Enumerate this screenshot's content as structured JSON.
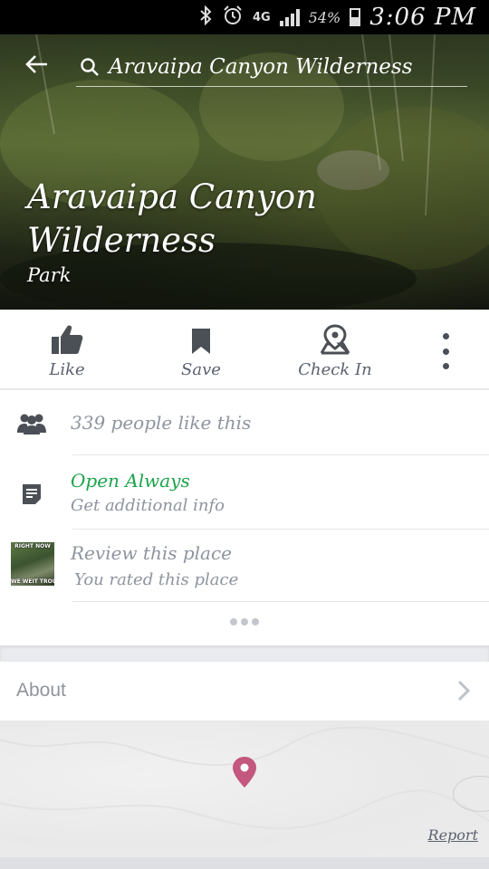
{
  "status_bar": {
    "icons": [
      "bluetooth-icon",
      "alarm-icon",
      "signal-icon",
      "battery-icon"
    ],
    "network": "4G",
    "battery": "54%",
    "time": "3:06 PM"
  },
  "header": {
    "search_query": "Aravaipa Canyon Wilderness",
    "title": "Aravaipa Canyon Wilderness",
    "category": "Park"
  },
  "actions": [
    {
      "label": "Like",
      "icon": "thumbs-up-icon"
    },
    {
      "label": "Save",
      "icon": "bookmark-icon"
    },
    {
      "label": "Check In",
      "icon": "map-pin-icon"
    }
  ],
  "info": {
    "likes": "339 people like this",
    "hours": "Open Always",
    "hours_sub": "Get additional info",
    "review": "Review this place",
    "review_sub": "You rated this place"
  },
  "about": {
    "title": "About"
  },
  "map": {
    "report_label": "Report"
  },
  "colors": {
    "accent_green": "#1ba34b",
    "icon_gray": "#4b4f56",
    "text_gray": "#8d949e",
    "pin_pink": "#c4577e"
  }
}
